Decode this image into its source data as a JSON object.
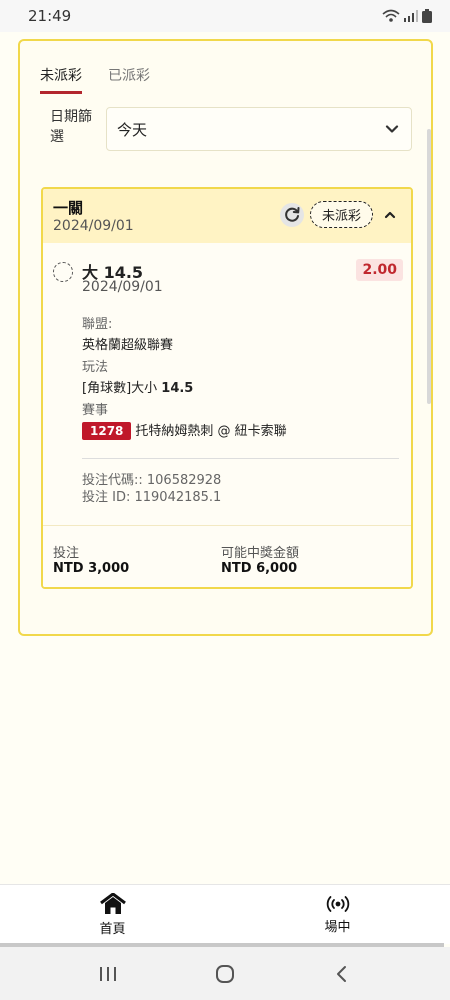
{
  "status_bar": {
    "time": "21:49"
  },
  "tabs": [
    {
      "label": "未派彩",
      "active": true
    },
    {
      "label": "已派彩",
      "active": false
    }
  ],
  "filter": {
    "label": "日期篩選",
    "label_line1": "日期篩",
    "label_line2": "選",
    "selected": "今天"
  },
  "bet": {
    "type": "一關",
    "date": "2024/09/01",
    "status": "未派彩",
    "selection": "大 14.5",
    "selection_date": "2024/09/01",
    "odds": "2.00",
    "league_label": "聯盟:",
    "league": "英格蘭超級聯賽",
    "market_label": "玩法",
    "market_prefix": "[角球數]大小 ",
    "market_line": "14.5",
    "event_label": "賽事",
    "event_id": "1278",
    "event_name": "托特納姆熱刺 @ 紐卡索聯",
    "bet_code": "投注代碼:: 106582928",
    "bet_id": "投注 ID: 119042185.1",
    "stake_label": "投注",
    "stake": "NTD 3,000",
    "potential_label": "可能中獎金額",
    "potential": "NTD 6,000"
  },
  "bottom_nav": [
    {
      "label": "首頁",
      "icon": "home-icon"
    },
    {
      "label": "場中",
      "icon": "live-icon"
    }
  ],
  "colors": {
    "accent_yellow": "#f1d84b",
    "brand_red": "#b3262e",
    "odds_red": "#c0282e",
    "event_badge": "#c0182a"
  }
}
